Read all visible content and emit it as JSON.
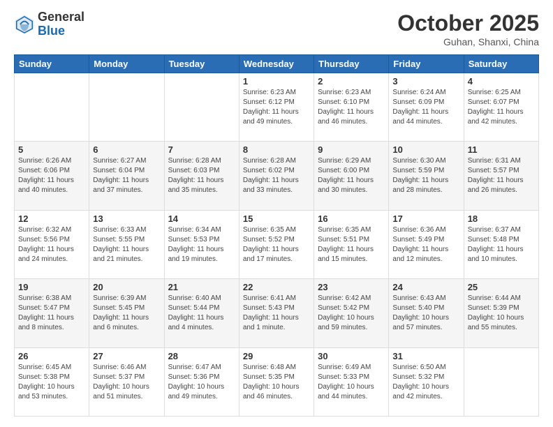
{
  "header": {
    "logo": {
      "general": "General",
      "blue": "Blue"
    },
    "month": "October 2025",
    "location": "Guhan, Shanxi, China"
  },
  "weekdays": [
    "Sunday",
    "Monday",
    "Tuesday",
    "Wednesday",
    "Thursday",
    "Friday",
    "Saturday"
  ],
  "weeks": [
    [
      {
        "day": "",
        "info": ""
      },
      {
        "day": "",
        "info": ""
      },
      {
        "day": "",
        "info": ""
      },
      {
        "day": "1",
        "info": "Sunrise: 6:23 AM\nSunset: 6:12 PM\nDaylight: 11 hours\nand 49 minutes."
      },
      {
        "day": "2",
        "info": "Sunrise: 6:23 AM\nSunset: 6:10 PM\nDaylight: 11 hours\nand 46 minutes."
      },
      {
        "day": "3",
        "info": "Sunrise: 6:24 AM\nSunset: 6:09 PM\nDaylight: 11 hours\nand 44 minutes."
      },
      {
        "day": "4",
        "info": "Sunrise: 6:25 AM\nSunset: 6:07 PM\nDaylight: 11 hours\nand 42 minutes."
      }
    ],
    [
      {
        "day": "5",
        "info": "Sunrise: 6:26 AM\nSunset: 6:06 PM\nDaylight: 11 hours\nand 40 minutes."
      },
      {
        "day": "6",
        "info": "Sunrise: 6:27 AM\nSunset: 6:04 PM\nDaylight: 11 hours\nand 37 minutes."
      },
      {
        "day": "7",
        "info": "Sunrise: 6:28 AM\nSunset: 6:03 PM\nDaylight: 11 hours\nand 35 minutes."
      },
      {
        "day": "8",
        "info": "Sunrise: 6:28 AM\nSunset: 6:02 PM\nDaylight: 11 hours\nand 33 minutes."
      },
      {
        "day": "9",
        "info": "Sunrise: 6:29 AM\nSunset: 6:00 PM\nDaylight: 11 hours\nand 30 minutes."
      },
      {
        "day": "10",
        "info": "Sunrise: 6:30 AM\nSunset: 5:59 PM\nDaylight: 11 hours\nand 28 minutes."
      },
      {
        "day": "11",
        "info": "Sunrise: 6:31 AM\nSunset: 5:57 PM\nDaylight: 11 hours\nand 26 minutes."
      }
    ],
    [
      {
        "day": "12",
        "info": "Sunrise: 6:32 AM\nSunset: 5:56 PM\nDaylight: 11 hours\nand 24 minutes."
      },
      {
        "day": "13",
        "info": "Sunrise: 6:33 AM\nSunset: 5:55 PM\nDaylight: 11 hours\nand 21 minutes."
      },
      {
        "day": "14",
        "info": "Sunrise: 6:34 AM\nSunset: 5:53 PM\nDaylight: 11 hours\nand 19 minutes."
      },
      {
        "day": "15",
        "info": "Sunrise: 6:35 AM\nSunset: 5:52 PM\nDaylight: 11 hours\nand 17 minutes."
      },
      {
        "day": "16",
        "info": "Sunrise: 6:35 AM\nSunset: 5:51 PM\nDaylight: 11 hours\nand 15 minutes."
      },
      {
        "day": "17",
        "info": "Sunrise: 6:36 AM\nSunset: 5:49 PM\nDaylight: 11 hours\nand 12 minutes."
      },
      {
        "day": "18",
        "info": "Sunrise: 6:37 AM\nSunset: 5:48 PM\nDaylight: 11 hours\nand 10 minutes."
      }
    ],
    [
      {
        "day": "19",
        "info": "Sunrise: 6:38 AM\nSunset: 5:47 PM\nDaylight: 11 hours\nand 8 minutes."
      },
      {
        "day": "20",
        "info": "Sunrise: 6:39 AM\nSunset: 5:45 PM\nDaylight: 11 hours\nand 6 minutes."
      },
      {
        "day": "21",
        "info": "Sunrise: 6:40 AM\nSunset: 5:44 PM\nDaylight: 11 hours\nand 4 minutes."
      },
      {
        "day": "22",
        "info": "Sunrise: 6:41 AM\nSunset: 5:43 PM\nDaylight: 11 hours\nand 1 minute."
      },
      {
        "day": "23",
        "info": "Sunrise: 6:42 AM\nSunset: 5:42 PM\nDaylight: 10 hours\nand 59 minutes."
      },
      {
        "day": "24",
        "info": "Sunrise: 6:43 AM\nSunset: 5:40 PM\nDaylight: 10 hours\nand 57 minutes."
      },
      {
        "day": "25",
        "info": "Sunrise: 6:44 AM\nSunset: 5:39 PM\nDaylight: 10 hours\nand 55 minutes."
      }
    ],
    [
      {
        "day": "26",
        "info": "Sunrise: 6:45 AM\nSunset: 5:38 PM\nDaylight: 10 hours\nand 53 minutes."
      },
      {
        "day": "27",
        "info": "Sunrise: 6:46 AM\nSunset: 5:37 PM\nDaylight: 10 hours\nand 51 minutes."
      },
      {
        "day": "28",
        "info": "Sunrise: 6:47 AM\nSunset: 5:36 PM\nDaylight: 10 hours\nand 49 minutes."
      },
      {
        "day": "29",
        "info": "Sunrise: 6:48 AM\nSunset: 5:35 PM\nDaylight: 10 hours\nand 46 minutes."
      },
      {
        "day": "30",
        "info": "Sunrise: 6:49 AM\nSunset: 5:33 PM\nDaylight: 10 hours\nand 44 minutes."
      },
      {
        "day": "31",
        "info": "Sunrise: 6:50 AM\nSunset: 5:32 PM\nDaylight: 10 hours\nand 42 minutes."
      },
      {
        "day": "",
        "info": ""
      }
    ]
  ]
}
